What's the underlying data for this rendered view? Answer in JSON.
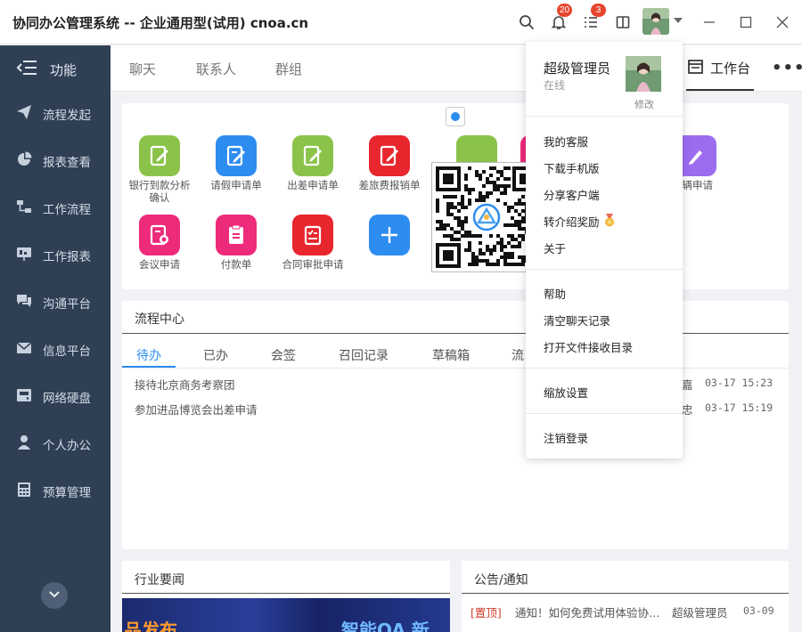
{
  "app": {
    "title": "协同办公管理系统 -- 企业通用型(试用) cnoa.cn",
    "notif_count": "20",
    "task_count": "3"
  },
  "sidebar": {
    "header": "功能",
    "items": [
      {
        "label": "流程发起",
        "icon": "send-icon"
      },
      {
        "label": "报表查看",
        "icon": "pie-chart-icon"
      },
      {
        "label": "工作流程",
        "icon": "workflow-icon"
      },
      {
        "label": "工作报表",
        "icon": "board-icon"
      },
      {
        "label": "沟通平台",
        "icon": "chat-icon"
      },
      {
        "label": "信息平台",
        "icon": "mail-icon"
      },
      {
        "label": "网络硬盘",
        "icon": "disk-icon"
      },
      {
        "label": "个人办公",
        "icon": "user-icon"
      },
      {
        "label": "预算管理",
        "icon": "calculator-icon"
      }
    ]
  },
  "tabs": {
    "chat": "聊天",
    "contacts": "联系人",
    "groups": "群组",
    "workbench": "工作台"
  },
  "apps": [
    {
      "label": "银行到款分析确认",
      "color": "#8bc34a"
    },
    {
      "label": "请假申请单",
      "color": "#2d8cf0"
    },
    {
      "label": "出差申请单",
      "color": "#8bc34a"
    },
    {
      "label": "差旅费报销单",
      "color": "#e8262e"
    },
    {
      "label": "车辆申请",
      "color": "#9c6cf0"
    },
    {
      "label": "会议申请",
      "color": "#ee2a7b"
    },
    {
      "label": "付款单",
      "color": "#ee2a7b"
    },
    {
      "label": "合同审批申请",
      "color": "#e8262e"
    }
  ],
  "process": {
    "title": "流程中心",
    "tabs": [
      "待办",
      "已办",
      "会签",
      "召回记录",
      "草稿箱",
      "流"
    ],
    "rows": [
      {
        "title": "接待北京商务考察团",
        "who": "嘉",
        "time": "03-17 15:23"
      },
      {
        "title": "参加进品博览会出差申请",
        "who": "忠",
        "time": "03-17 15:19"
      }
    ]
  },
  "news": {
    "title": "行业要闻",
    "banner_left": "品发布",
    "banner_right": "智能OA 新"
  },
  "notice": {
    "title": "公告/通知",
    "tag": "[置顶]",
    "text": "通知！如何免费试用体验协同办公",
    "user": "超级管理员",
    "date": "03-09"
  },
  "dropdown": {
    "name": "超级管理员",
    "status": "在线",
    "edit": "修改",
    "items_a": [
      "我的客服",
      "下载手机版",
      "分享客户端",
      "转介绍奖励"
    ],
    "about": "关于",
    "items_b": [
      "帮助",
      "清空聊天记录",
      "打开文件接收目录"
    ],
    "zoom": "缩放设置",
    "logout": "注销登录"
  }
}
